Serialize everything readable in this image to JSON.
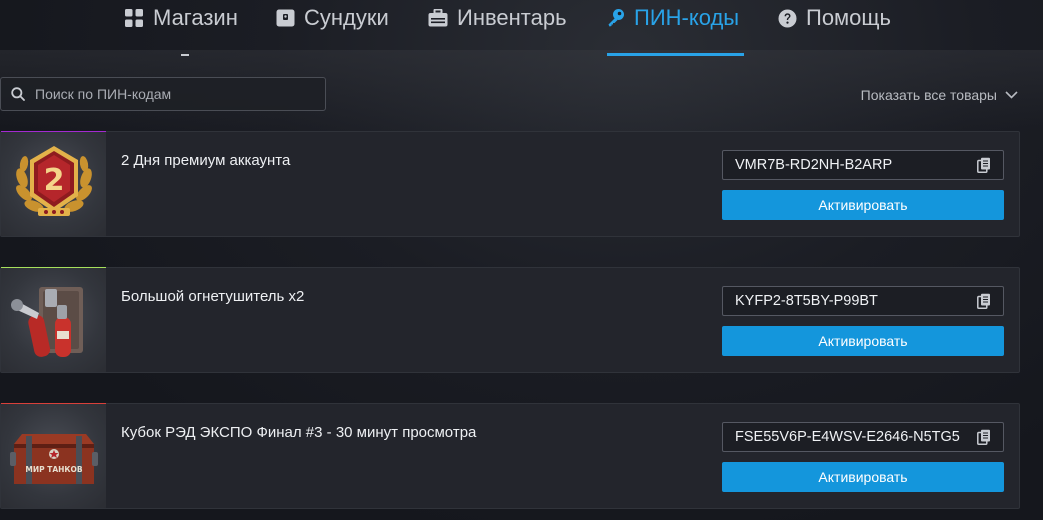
{
  "nav": {
    "items": [
      {
        "label": "Магазин",
        "icon": "grid-icon"
      },
      {
        "label": "Сундуки",
        "icon": "chest-icon"
      },
      {
        "label": "Инвентарь",
        "icon": "inventory-icon"
      },
      {
        "label": "ПИН-коды",
        "icon": "key-icon",
        "active": true
      },
      {
        "label": "Помощь",
        "icon": "help-icon"
      }
    ]
  },
  "search": {
    "placeholder": "Поиск по ПИН-кодам",
    "value": ""
  },
  "filter": {
    "label": "Показать все товары",
    "icon": "chevron-down-icon"
  },
  "colors": {
    "accent": "#29a3e8",
    "button": "#1496dc",
    "card_1_bar": "#a32ad1",
    "card_2_bar": "#a6e05c",
    "card_3_bar": "#d9403a"
  },
  "cards": [
    {
      "title": "2 Дня премиум аккаунта",
      "code": "VMR7B-RD2NH-B2ARP",
      "button": "Активировать",
      "thumb_icon": "premium-badge-icon",
      "badge_number": "2"
    },
    {
      "title": "Большой огнетушитель x2",
      "code": "KYFP2-8T5BY-P99BT",
      "button": "Активировать",
      "thumb_icon": "fire-extinguisher-icon"
    },
    {
      "title": "Кубок РЭД ЭКСПО Финал #3 - 30 минут просмотра",
      "code": "FSE55V6P-E4WSV-E2646-N5TG5",
      "button": "Активировать",
      "thumb_icon": "wot-chest-icon",
      "chest_label": "МИР ТАНКОВ"
    }
  ]
}
